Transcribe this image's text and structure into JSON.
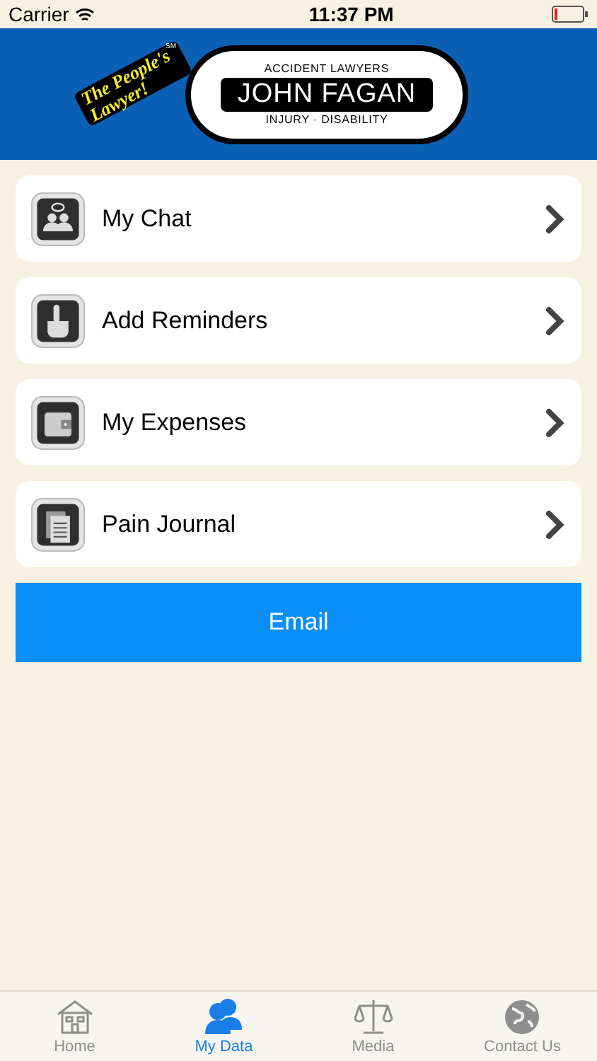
{
  "status_bar": {
    "carrier": "Carrier",
    "time": "11:37 PM"
  },
  "header": {
    "logo": {
      "slogan": "The People's Lawyer!",
      "service_mark": "SM",
      "top_line": "ACCIDENT LAWYERS",
      "name": "JOHN FAGAN",
      "bottom_line": "INJURY · DISABILITY"
    }
  },
  "menu": [
    {
      "kind": "chat",
      "label": "My Chat"
    },
    {
      "kind": "reminder",
      "label": "Add Reminders"
    },
    {
      "kind": "wallet",
      "label": "My Expenses"
    },
    {
      "kind": "journal",
      "label": "Pain Journal"
    }
  ],
  "email_button": {
    "label": "Email"
  },
  "tab_bar": [
    {
      "kind": "home",
      "label": "Home",
      "selected": false
    },
    {
      "kind": "people",
      "label": "My Data",
      "selected": true
    },
    {
      "kind": "scales",
      "label": "Media",
      "selected": false
    },
    {
      "kind": "globe",
      "label": "Contact Us",
      "selected": false
    }
  ]
}
